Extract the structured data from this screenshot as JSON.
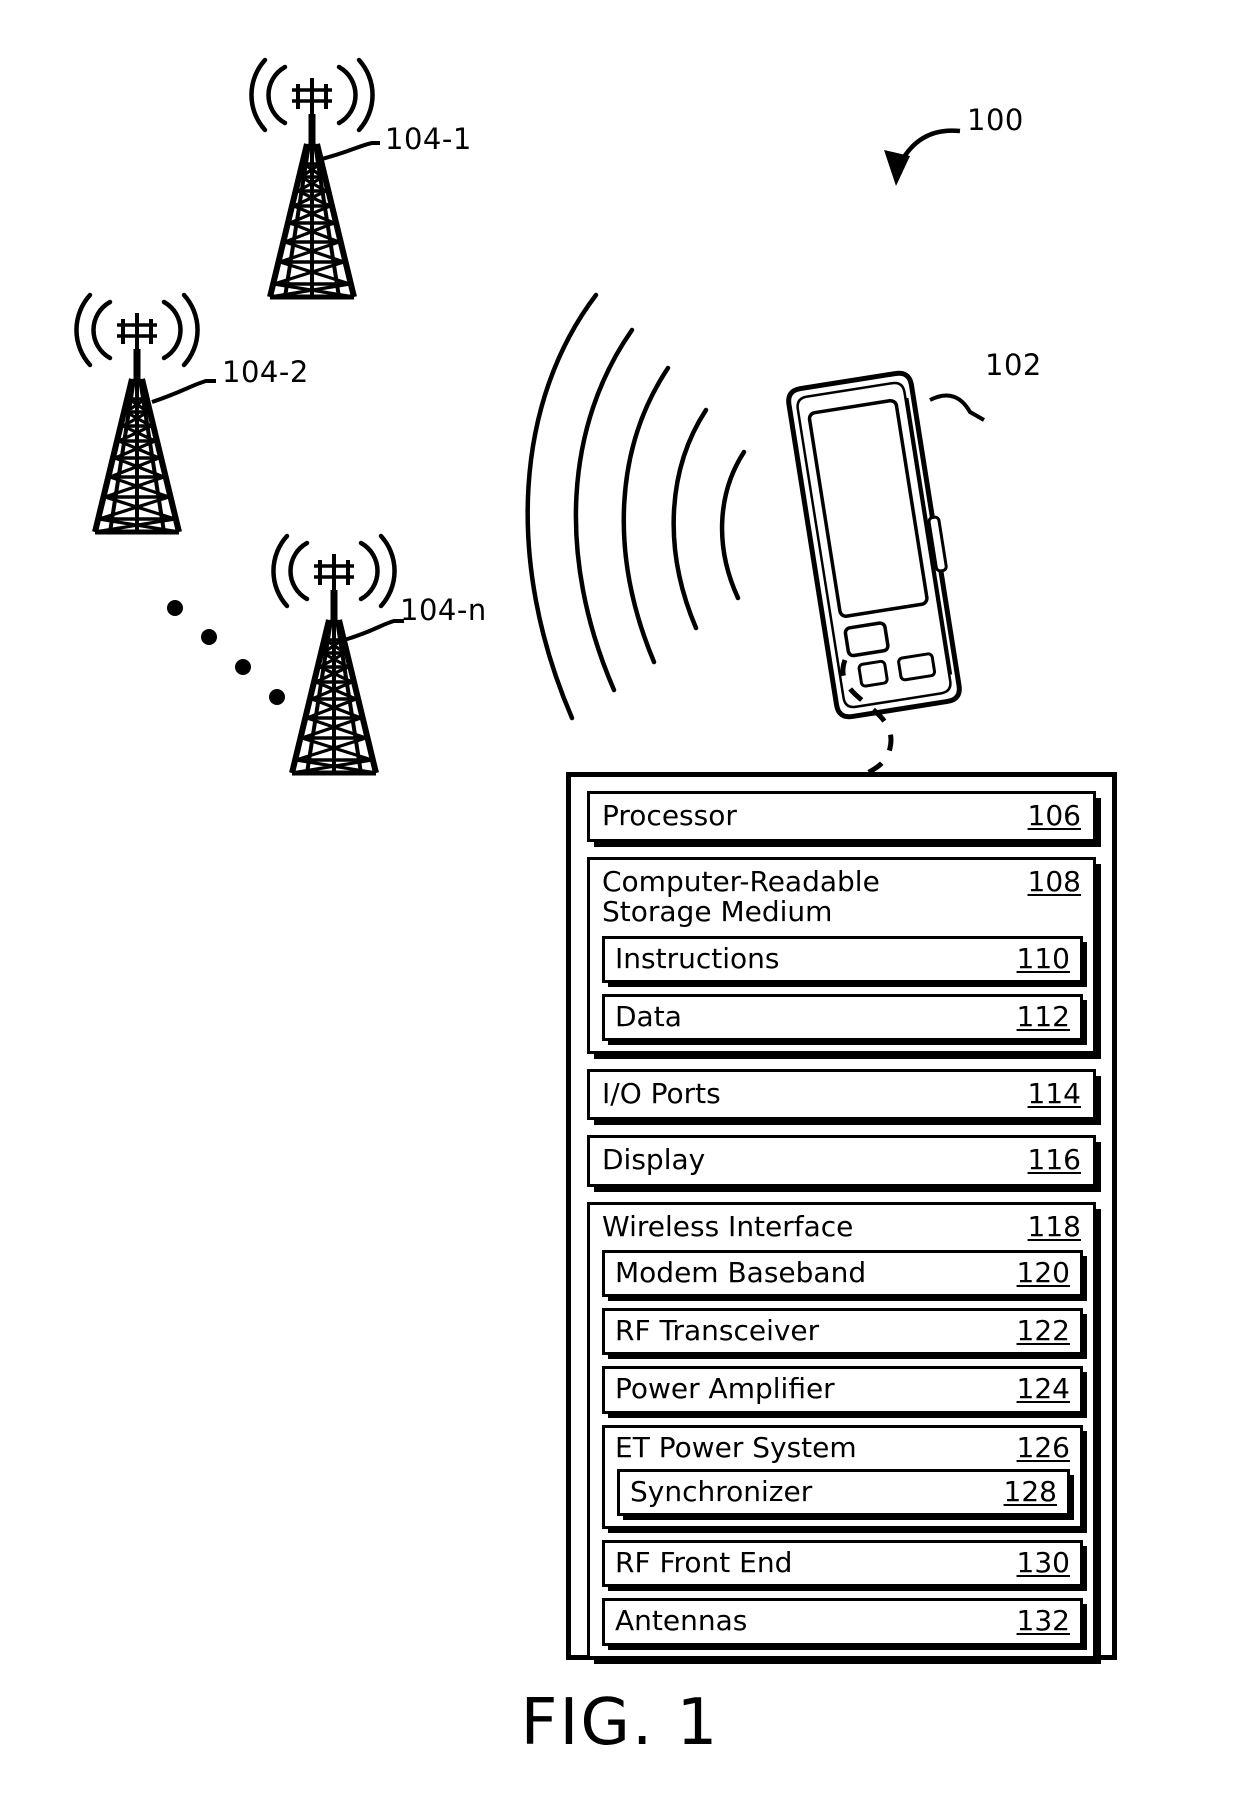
{
  "figure": {
    "caption": "FIG. 1",
    "system_ref": "100",
    "device_ref": "102"
  },
  "towers": [
    {
      "ref": "104-1",
      "icon": "cell-tower-icon"
    },
    {
      "ref": "104-2",
      "icon": "cell-tower-icon"
    },
    {
      "ref": "104-n",
      "icon": "cell-tower-icon"
    }
  ],
  "device": {
    "icon": "mobile-phone-icon",
    "blocks": [
      {
        "label": "Processor",
        "num": "106"
      },
      {
        "label": "Computer-Readable\nStorage Medium",
        "num": "108",
        "children": [
          {
            "label": "Instructions",
            "num": "110"
          },
          {
            "label": "Data",
            "num": "112"
          }
        ]
      },
      {
        "label": "I/O Ports",
        "num": "114"
      },
      {
        "label": "Display",
        "num": "116"
      },
      {
        "label": "Wireless Interface",
        "num": "118",
        "children": [
          {
            "label": "Modem Baseband",
            "num": "120"
          },
          {
            "label": "RF Transceiver",
            "num": "122"
          },
          {
            "label": "Power Amplifier",
            "num": "124"
          },
          {
            "label": "ET Power System",
            "num": "126",
            "children": [
              {
                "label": "Synchronizer",
                "num": "128"
              }
            ]
          },
          {
            "label": "RF Front End",
            "num": "130"
          },
          {
            "label": "Antennas",
            "num": "132"
          }
        ]
      }
    ]
  },
  "colors": {
    "ink": "#000000",
    "paper": "#ffffff"
  }
}
